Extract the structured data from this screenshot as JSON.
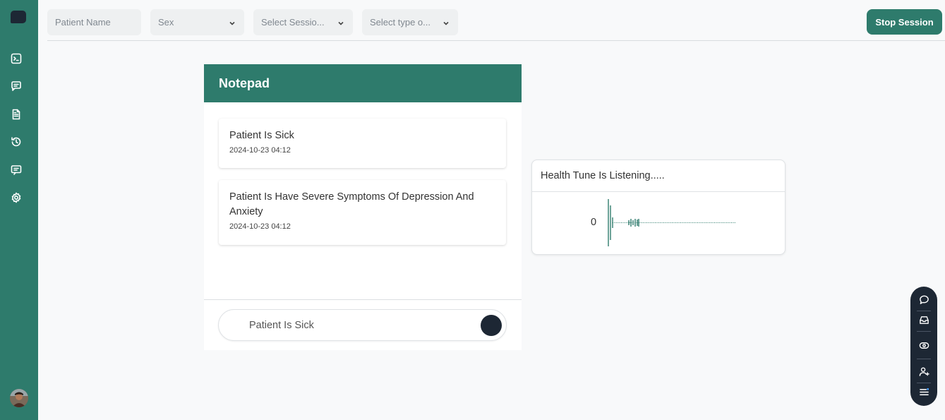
{
  "sidebar": {
    "icons": [
      "terminal-icon",
      "chat-icon",
      "document-icon",
      "history-icon",
      "message-icon",
      "settings-icon"
    ]
  },
  "topbar": {
    "patient_name_placeholder": "Patient Name",
    "sex_value": "Sex",
    "session_value": "Select Sessio...",
    "type_value": "Select type o...",
    "stop_label": "Stop Session"
  },
  "notepad": {
    "title": "Notepad",
    "notes": [
      {
        "title": "Patient Is Sick",
        "time": "2024-10-23 04:12"
      },
      {
        "title": "Patient Is Have Severe Symptoms Of Depression And Anxiety",
        "time": "2024-10-23 04:12"
      }
    ],
    "input_value": "Patient Is Sick"
  },
  "listening": {
    "title": "Health Tune Is Listening.....",
    "count": "0"
  },
  "floating_toolbar": {
    "icons": [
      "comment-icon",
      "inbox-icon",
      "eye-icon",
      "add-user-icon",
      "menu-icon"
    ]
  },
  "colors": {
    "primary": "#2e7b6c",
    "dark": "#1d2734",
    "background": "#f8f9fa"
  }
}
